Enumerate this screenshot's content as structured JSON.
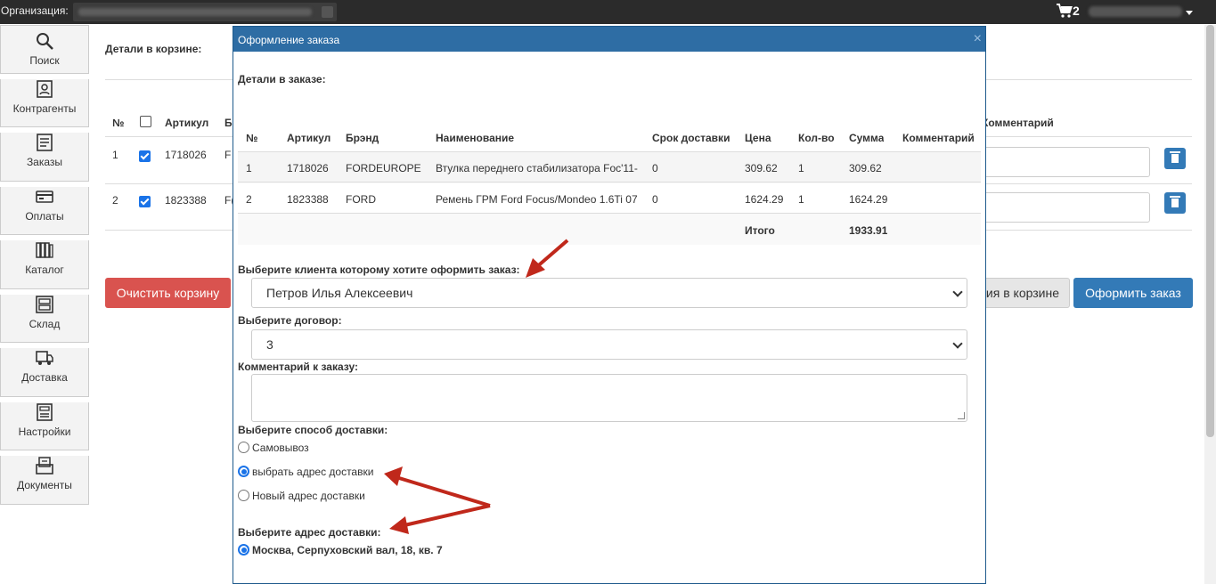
{
  "topbar": {
    "org_label": "Организация:",
    "cart_count": "2"
  },
  "sidebar": {
    "items": [
      {
        "label": "Поиск",
        "icon": "search-icon"
      },
      {
        "label": "Контрагенты",
        "icon": "contacts-icon"
      },
      {
        "label": "Заказы",
        "icon": "orders-icon"
      },
      {
        "label": "Оплаты",
        "icon": "payments-icon"
      },
      {
        "label": "Каталог",
        "icon": "catalog-icon"
      },
      {
        "label": "Склад",
        "icon": "warehouse-icon"
      },
      {
        "label": "Доставка",
        "icon": "delivery-icon"
      },
      {
        "label": "Настройки",
        "icon": "settings-icon"
      },
      {
        "label": "Документы",
        "icon": "documents-icon"
      }
    ]
  },
  "cart_page": {
    "title": "Детали в корзине:",
    "columns": {
      "num": "№",
      "article": "Артикул",
      "brand_partial": "Б",
      "comment": "Комментарий"
    },
    "rows": [
      {
        "num": "1",
        "article": "1718026",
        "brand_partial": "F"
      },
      {
        "num": "2",
        "article": "1823388",
        "brand_partial": "F("
      }
    ],
    "clear_button": "Очистить корзину",
    "cart_actions_partial": "ия в корзине",
    "order_button": "Оформить заказ"
  },
  "modal": {
    "title": "Оформление заказа",
    "close": "×",
    "details_label": "Детали в заказе:",
    "columns": [
      "№",
      "Артикул",
      "Брэнд",
      "Наименование",
      "Срок доставки",
      "Цена",
      "Кол-во",
      "Сумма",
      "Комментарий"
    ],
    "rows": [
      {
        "num": "1",
        "article": "1718026",
        "brand": "FORDEUROPE",
        "name": "Втулка переднего стабилизатора Foc'11-",
        "delivery": "0",
        "price": "309.62",
        "qty": "1",
        "sum": "309.62",
        "comment": ""
      },
      {
        "num": "2",
        "article": "1823388",
        "brand": "FORD",
        "name": "Ремень ГРМ Ford Focus/Mondeo 1.6Ti 07",
        "delivery": "0",
        "price": "1624.29",
        "qty": "1",
        "sum": "1624.29",
        "comment": ""
      }
    ],
    "total_label": "Итого",
    "total_value": "1933.91",
    "client_label": "Выберите клиента которому хотите оформить заказ:",
    "client_value": "Петров Илья Алексеевич",
    "contract_label": "Выберите договор:",
    "contract_value": "3",
    "comment_label": "Комментарий к заказу:",
    "delivery_label": "Выберите способ доставки:",
    "delivery_options": [
      {
        "label": "Самовывоз",
        "selected": false
      },
      {
        "label": "выбрать адрес доставки",
        "selected": true
      },
      {
        "label": "Новый адрес доставки",
        "selected": false
      }
    ],
    "address_label": "Выберите адрес доставки:",
    "address_value": "Москва, Серпуховский вал, 18, кв. 7"
  },
  "colors": {
    "topbar": "#2b2b2b",
    "modal_header": "#2e6da4",
    "primary": "#337ab7",
    "danger": "#d9534f",
    "arrow": "#c0281b"
  }
}
